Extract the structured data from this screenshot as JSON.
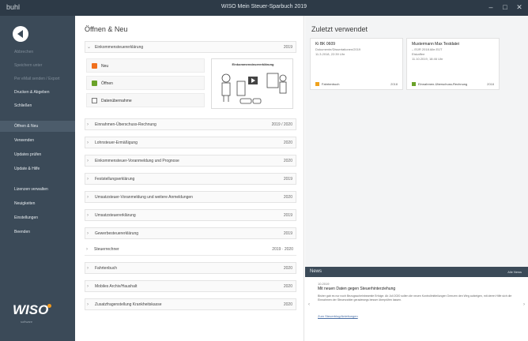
{
  "window": {
    "app_label": "buhl",
    "title": "WISO Mein Steuer-Sparbuch 2019",
    "controls": {
      "minimize": "–",
      "maximize": "□",
      "close": "✕"
    }
  },
  "sidebar": {
    "items": [
      {
        "label": "Abbrechen",
        "dim": true
      },
      {
        "label": "Speichern unter",
        "dim": true
      },
      {
        "label": "Per eMail senden / Export",
        "dim": true
      },
      {
        "label": "Drucken & Abgeben",
        "dim": false
      },
      {
        "label": "Schließen",
        "dim": false
      },
      {
        "label": "Öffnen & Neu",
        "dim": false,
        "active": true
      },
      {
        "label": "Verwenden",
        "dim": false
      },
      {
        "label": "Updates prüfen",
        "dim": false
      },
      {
        "label": "Update & Hilfe",
        "dim": false
      },
      {
        "label": "Lizenzen verwalten",
        "dim": false
      },
      {
        "label": "Neuigkeiten",
        "dim": false
      },
      {
        "label": "Einstellungen",
        "dim": false
      },
      {
        "label": "Beenden",
        "dim": false
      }
    ],
    "logo_text": "WISO",
    "logo_sub": "software"
  },
  "main": {
    "heading": "Öffnen & Neu",
    "first_row": {
      "label": "Einkommensteuererklärung",
      "year": "2019"
    },
    "actions": [
      {
        "label": "Neu",
        "icon": "new-document-icon"
      },
      {
        "label": "Öffnen",
        "icon": "open-folder-icon"
      },
      {
        "label": "Datenübernahme",
        "icon": "data-import-icon"
      }
    ],
    "info_caption": "Einkommensteuererklärung",
    "rows": [
      {
        "label": "Einnahmen-Überschuss-Rechnung",
        "year": "2019 / 2020"
      },
      {
        "label": "Lohnsteuer-Ermäßigung",
        "year": "2020"
      },
      {
        "label": "Einkommensteuer-Voranmeldung und Prognose",
        "year": "2020"
      },
      {
        "label": "Feststellungserklärung",
        "year": "2019"
      },
      {
        "label": "Umsatzsteuer-Voranmeldung und weitere Anmeldungen",
        "year": "2020"
      },
      {
        "label": "Umsatzsteuererklärung",
        "year": "2019"
      },
      {
        "label": "Gewerbesteuererklärung",
        "year": "2019"
      },
      {
        "label": "Steuerrechner",
        "year": "2019 · 2020"
      },
      {
        "label": "Fahrtenbuch",
        "year": "2020"
      },
      {
        "label": "Mobiles Archiv/Haushalt",
        "year": "2020"
      },
      {
        "label": "Zusatzfragenstellung Krankheitskasse",
        "year": "2020"
      }
    ]
  },
  "recent": {
    "heading": "Zuletzt verwendet",
    "cards": [
      {
        "name": "Ki BK 0609",
        "line2": "Dokumente/Dissertationen/2019",
        "line3": "11.3.2018, 22:39 Uhr",
        "line4": "",
        "footer": "Fahrtenbuch",
        "year": "2018",
        "icon_color": "#f0a21d"
      },
      {
        "name": "Mustermann Max Testdatei",
        "line2": "– EÜR 2018 Alle.EÜT",
        "line3": "Eiskaffee",
        "line4": "11.10.2019, 18:46 Uhr",
        "footer": "Einnahmen-Überschuss-Rechnung",
        "year": "2018",
        "icon_color": "#6aa229"
      }
    ]
  },
  "news": {
    "title": "News",
    "all_label": "Alle News",
    "date": "10.2019",
    "headline": "Mit neuen Daten gegen Steuerhinterziehung",
    "body": "Bisher gab es nur noch Bezugsscheinbeamtle Erfolge. Ab Juli 2020 sollen die neuen Kontrollmitteilungen Grenzen den Weg aufzeigen, mit deren Hilfe sich die Einnahmen der Steuerzahler geradewegs besser überprüfen lassen.",
    "more": "Zum Steuerblog/Anleitungen"
  }
}
